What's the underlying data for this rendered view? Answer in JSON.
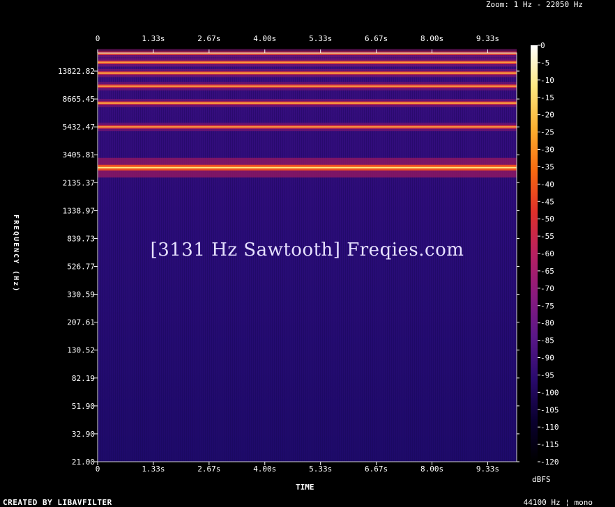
{
  "header": {
    "zoom": "Zoom: 1 Hz - 22050 Hz"
  },
  "footer": {
    "created": "CREATED BY LIBAVFILTER",
    "rate": "44100 Hz ¦ mono"
  },
  "watermark": "[3131 Hz Sawtooth] Freqies.com",
  "chart_data": {
    "type": "heatmap",
    "title": "",
    "xlabel": "TIME",
    "ylabel": "FREQUENCY (Hz)",
    "colorbar_label": "dBFS",
    "x_ticks": [
      "0",
      "1.33s",
      "2.67s",
      "4.00s",
      "5.33s",
      "6.67s",
      "8.00s",
      "9.33s"
    ],
    "y_ticks": [
      "21.00",
      "32.90",
      "51.90",
      "82.19",
      "130.52",
      "207.61",
      "330.59",
      "526.77",
      "839.73",
      "1338.97",
      "2135.37",
      "3405.81",
      "5432.47",
      "8665.45",
      "13822.82"
    ],
    "colorbar_ticks": [
      "0",
      "-5",
      "-10",
      "-15",
      "-20",
      "-25",
      "-30",
      "-35",
      "-40",
      "-45",
      "-50",
      "-55",
      "-60",
      "-65",
      "-70",
      "-75",
      "-80",
      "-85",
      "-90",
      "-95",
      "-100",
      "-105",
      "-110",
      "-115",
      "-120"
    ],
    "xlim": [
      0,
      10
    ],
    "ylim": [
      21,
      22050
    ],
    "y_scale": "log",
    "clim": [
      -120,
      0
    ],
    "harmonics_hz": [
      3131,
      6262,
      9393,
      12524,
      15655,
      18786,
      21917
    ],
    "background_db": -95,
    "colormap": [
      "#000000",
      "#0a0030",
      "#2a0a6e",
      "#5a1788",
      "#8a1a7e",
      "#b82060",
      "#e0302a",
      "#f86a10",
      "#fcb030",
      "#fde880",
      "#ffffff"
    ]
  }
}
